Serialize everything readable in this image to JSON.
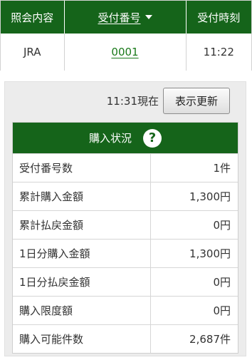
{
  "inquiry_table": {
    "headers": {
      "content": "照会内容",
      "receipt_number": "受付番号",
      "receipt_time": "受付時刻"
    },
    "row": {
      "content": "JRA",
      "receipt_number": "0001",
      "receipt_time": "11:22"
    }
  },
  "refresh": {
    "as_of": "11:31現在",
    "button_label": "表示更新"
  },
  "purchase_status": {
    "title": "購入状況",
    "help_symbol": "?",
    "rows": [
      {
        "label": "受付番号数",
        "value": "1件"
      },
      {
        "label": "累計購入金額",
        "value": "1,300円"
      },
      {
        "label": "累計払戻金額",
        "value": "0円"
      },
      {
        "label": "1日分購入金額",
        "value": "1,300円"
      },
      {
        "label": "1日分払戻金額",
        "value": "0円"
      },
      {
        "label": "購入限度額",
        "value": "0円"
      },
      {
        "label": "購入可能件数",
        "value": "2,687件"
      }
    ]
  },
  "colors": {
    "header_green": "#15641a",
    "link_green": "#1a7a1a",
    "panel_gray": "#ececec"
  },
  "icons": {
    "sort": "sort-desc-arrow",
    "help": "question-circle"
  }
}
